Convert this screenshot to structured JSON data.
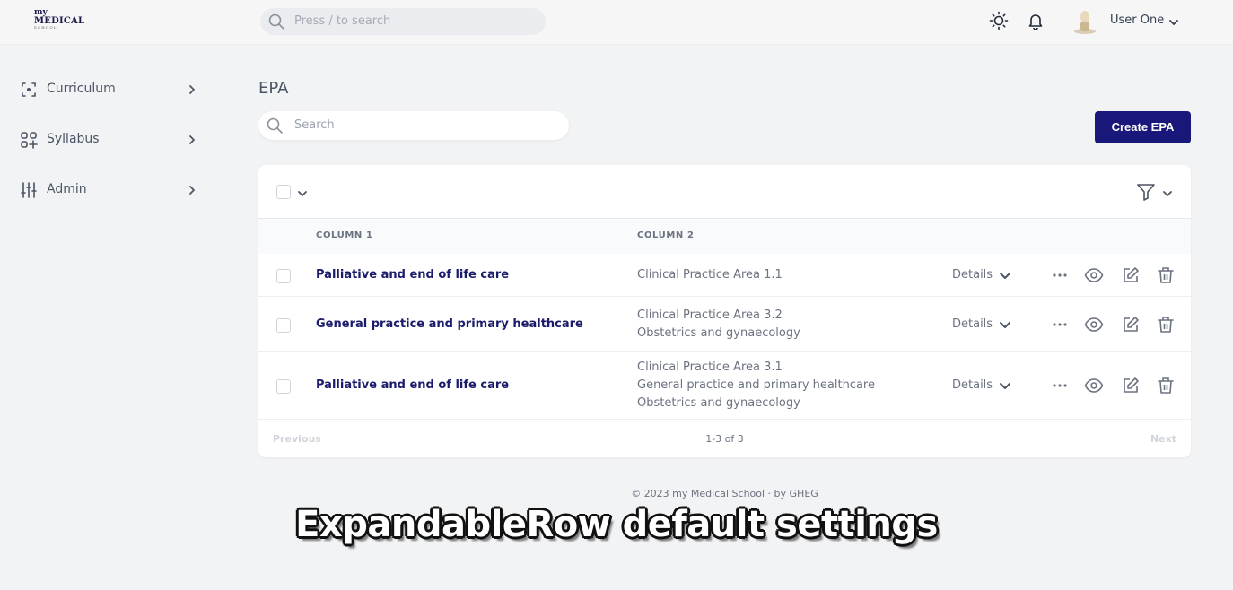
{
  "brand": {
    "logo_line1": "my",
    "logo_line2": "MEDICAL",
    "logo_line3": "SCHOOL"
  },
  "header": {
    "search_placeholder": "Press / to search",
    "user_name": "User One",
    "icons": [
      "search-icon",
      "sun-icon",
      "bell-icon",
      "avatar",
      "chevron-down-icon"
    ]
  },
  "sidebar": {
    "items": [
      {
        "label": "Curriculum",
        "icon": "curriculum-icon"
      },
      {
        "label": "Syllabus",
        "icon": "syllabus-icon"
      },
      {
        "label": "Admin",
        "icon": "sliders-icon"
      }
    ]
  },
  "main": {
    "title": "EPA",
    "search_placeholder": "Search",
    "create_button": "Create EPA"
  },
  "table": {
    "columns": [
      "COLUMN 1",
      "COLUMN 2"
    ],
    "rows": [
      {
        "name": "Palliative and end of life care",
        "col2": [
          "Clinical Practice Area 1.1"
        ],
        "details": "Details"
      },
      {
        "name": "General practice and primary healthcare",
        "col2": [
          "Clinical Practice Area 3.2",
          "Obstetrics and gynaecology"
        ],
        "details": "Details"
      },
      {
        "name": "Palliative and end of life care",
        "col2": [
          "Clinical Practice Area 3.1",
          "General practice and primary healthcare",
          "Obstetrics and gynaecology"
        ],
        "details": "Details"
      }
    ],
    "pagination": {
      "previous": "Previous",
      "info": "1-3 of 3",
      "next": "Next"
    }
  },
  "footer": {
    "copyright": "© 2023 my Medical School · by GHEG"
  },
  "caption": "ExpandableRow default settings",
  "colors": {
    "accent": "#19187a",
    "row_title": "#1b1b6b",
    "background": "#f2f3f5"
  }
}
